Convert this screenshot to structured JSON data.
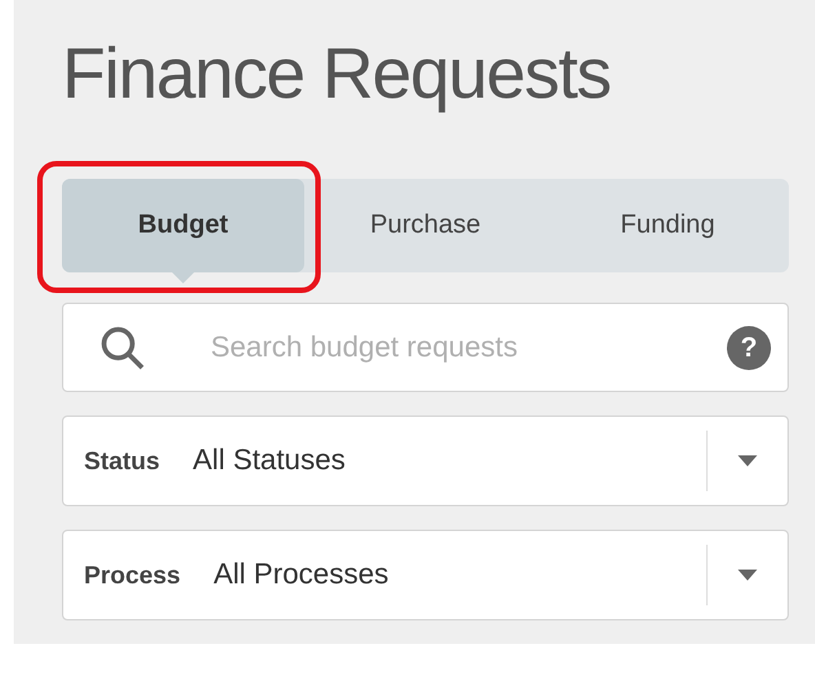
{
  "title": "Finance Requests",
  "tabs": [
    {
      "label": "Budget",
      "selected": true,
      "highlighted": true
    },
    {
      "label": "Purchase",
      "selected": false,
      "highlighted": false
    },
    {
      "label": "Funding",
      "selected": false,
      "highlighted": false
    }
  ],
  "search": {
    "placeholder": "Search budget requests",
    "help_icon": "?"
  },
  "filters": [
    {
      "label": "Status",
      "value": "All Statuses"
    },
    {
      "label": "Process",
      "value": "All Processes"
    }
  ]
}
